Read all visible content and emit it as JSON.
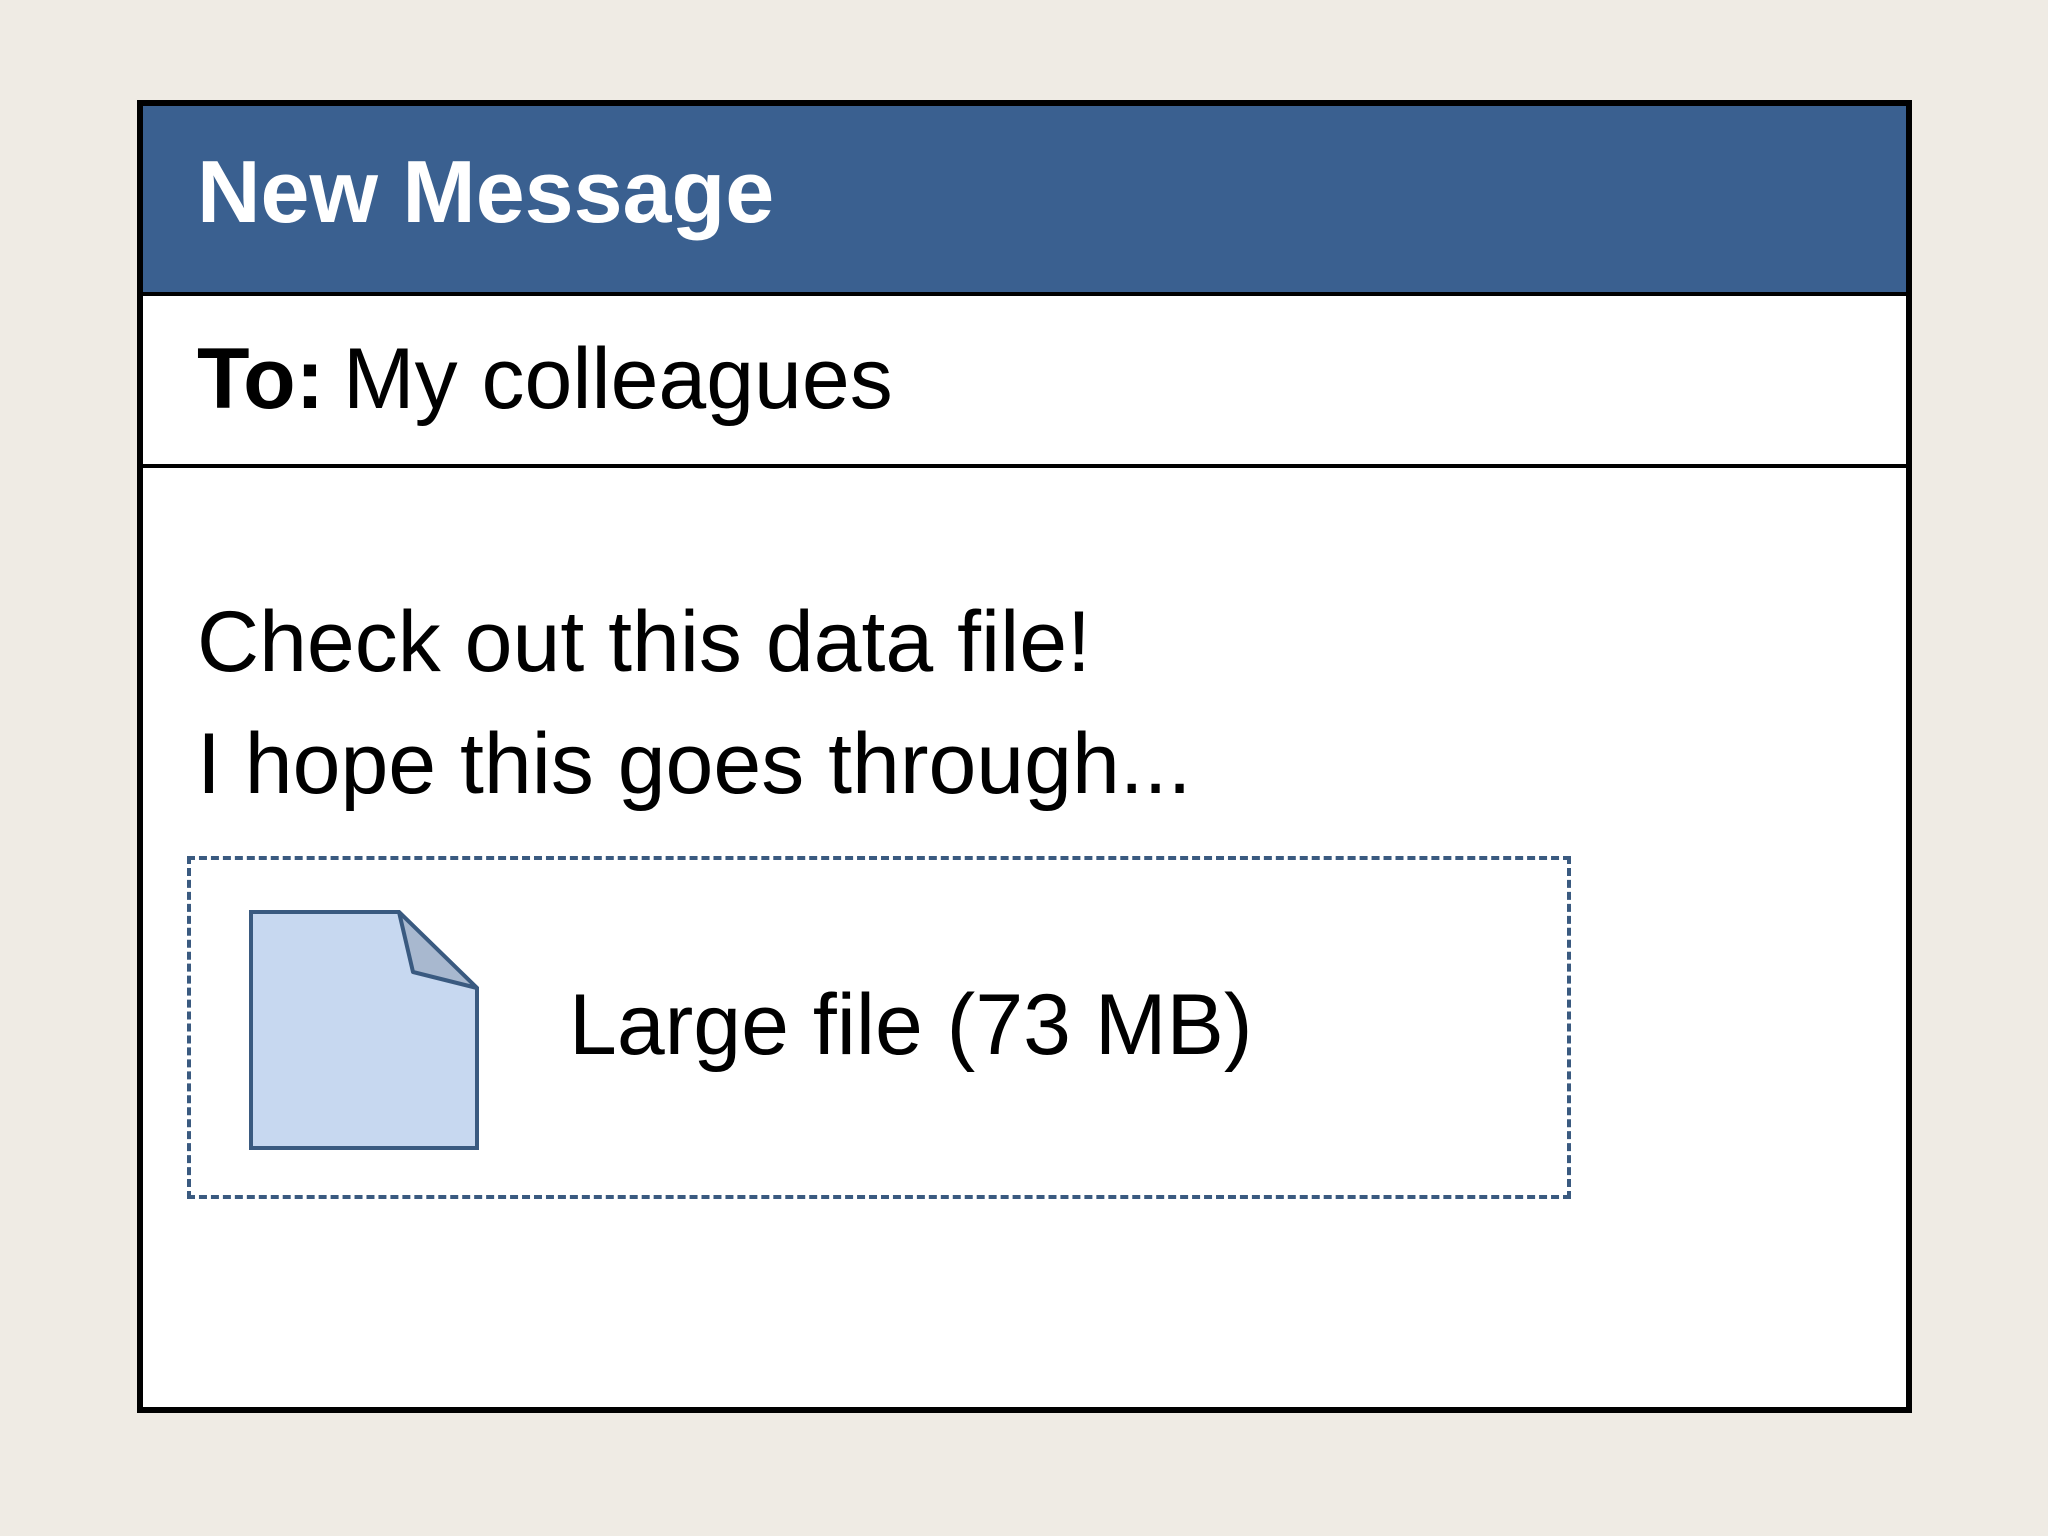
{
  "window": {
    "title": "New Message"
  },
  "recipient": {
    "label": "To:",
    "value": "My colleagues"
  },
  "message": {
    "lines": [
      "Check out this data file!",
      "I hope this goes through..."
    ]
  },
  "attachment": {
    "icon": "document-icon",
    "label": "Large file (73 MB)"
  },
  "colors": {
    "title_bar": "#3a6090",
    "background": "#efebe4",
    "file_icon_fill": "#c7d8f0",
    "file_icon_stroke": "#3a5a80",
    "file_icon_fold": "#a8b8cf"
  }
}
